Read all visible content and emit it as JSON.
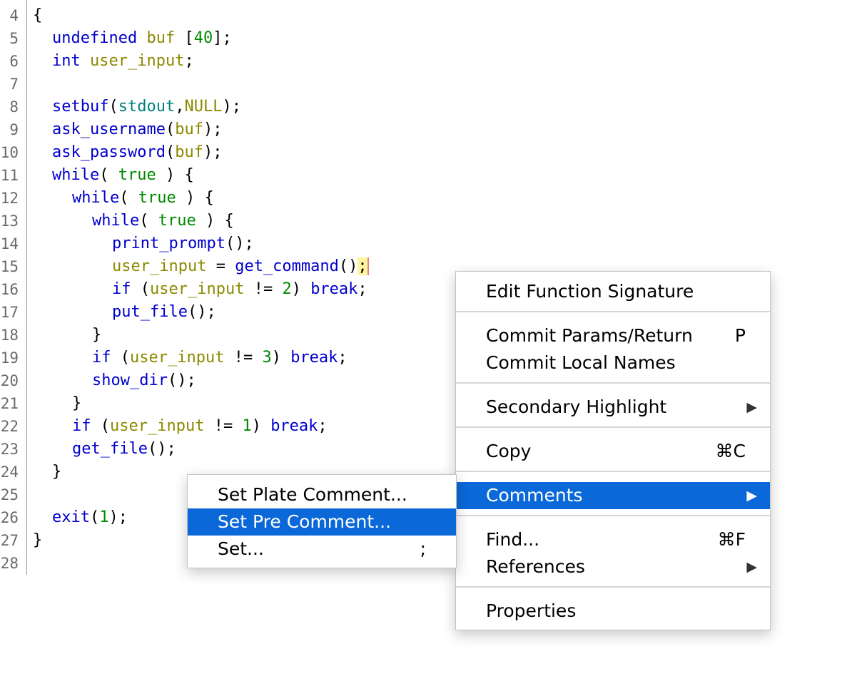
{
  "editor": {
    "line_numbers": [
      "4",
      "5",
      "6",
      "7",
      "8",
      "9",
      "10",
      "11",
      "12",
      "13",
      "14",
      "15",
      "16",
      "17",
      "18",
      "19",
      "20",
      "21",
      "22",
      "23",
      "24",
      "25",
      "26",
      "27",
      "28"
    ],
    "code": {
      "open_brace": "{",
      "l5_type": "undefined",
      "l5_var": "buf",
      "l5_open": " [",
      "l5_num": "40",
      "l5_close": "];",
      "l6_type": "int",
      "l6_var": "user_input",
      "l6_end": ";",
      "l8_fn": "setbuf",
      "l8_open": "(",
      "l8_arg1": "stdout",
      "l8_comma": ",",
      "l8_arg2": "NULL",
      "l8_end": ");",
      "l9_fn": "ask_username",
      "l9_open": "(",
      "l9_arg": "buf",
      "l9_end": ");",
      "l10_fn": "ask_password",
      "l10_open": "(",
      "l10_arg": "buf",
      "l10_end": ");",
      "while_kw": "while",
      "while_open": "( ",
      "true_kw": "true",
      "while_close": " ) {",
      "l14_fn": "print_prompt",
      "l14_end": "();",
      "l15_var": "user_input",
      "l15_eq": " = ",
      "l15_fn": "get_command",
      "l15_parens": "()",
      "l15_semi": ";",
      "if_kw": "if",
      "if_open": " (",
      "l16_var": "user_input",
      "l16_op": " != ",
      "l16_num": "2",
      "if_close": ") ",
      "break_kw": "break",
      "break_end": ";",
      "l17_fn": "put_file",
      "l17_end": "();",
      "close_brace": "}",
      "l19_var": "user_input",
      "l19_op": " != ",
      "l19_num": "3",
      "l20_fn": "show_dir",
      "l20_end": "();",
      "l22_var": "user_input",
      "l22_op": " != ",
      "l22_num": "1",
      "l23_fn": "get_file",
      "l23_end": "();",
      "l26_fn": "exit",
      "l26_open": "(",
      "l26_num": "1",
      "l26_end": ");"
    }
  },
  "context_menu": {
    "edit_signature": "Edit Function Signature",
    "commit_params": "Commit Params/Return",
    "commit_params_shortcut": "P",
    "commit_local_names": "Commit Local Names",
    "secondary_highlight": "Secondary Highlight",
    "copy": "Copy",
    "copy_shortcut": "⌘C",
    "comments": "Comments",
    "find": "Find...",
    "find_shortcut": "⌘F",
    "references": "References",
    "properties": "Properties",
    "submenu_arrow": "▶"
  },
  "comments_submenu": {
    "set_plate": "Set Plate Comment...",
    "set_pre": "Set Pre Comment...",
    "set_other": "Set...",
    "set_other_shortcut": ";"
  },
  "colors": {
    "keyword": "#0000cc",
    "variable": "#8a8a00",
    "number": "#008a00",
    "global": "#008080",
    "selection": "#0a68d8",
    "cursor_highlight": "#fff59d"
  }
}
